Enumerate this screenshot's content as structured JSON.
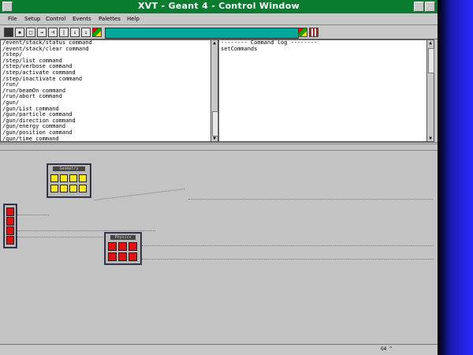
{
  "window": {
    "title": "XVT - Geant 4 - Control Window"
  },
  "menu": [
    "File",
    "Setup",
    "Control",
    "Events",
    "Palettes",
    "Help"
  ],
  "toolbar": {
    "buttons": [
      "save-icon",
      "print-icon",
      "window-icon",
      "arrow-icon",
      "tool-icon",
      "tool-icon",
      "tool-icon",
      "tool-icon",
      "color-icon"
    ],
    "command_value": "",
    "right_buttons": [
      "color-icon",
      "grid-icon"
    ],
    "command_field_color": "#00a89a"
  },
  "command_list": [
    "/event/stack/status command",
    "/event/stack/clear command",
    "/step/",
    "/step/list command",
    "/step/verbose command",
    "/step/activate command",
    "/step/inactivate command",
    "/run/",
    "/run/beamOn command",
    "/run/abort command",
    "/gun/",
    "/gun/List command",
    "/gun/particle command",
    "/gun/direction command",
    "/gun/energy command",
    "/gun/position command",
    "/gun/time command"
  ],
  "command_log": {
    "header": "-------- Command log --------",
    "lines": [
      "setCommands"
    ]
  },
  "palettes": [
    {
      "name": "Geometry",
      "color": "#ffe81a"
    },
    {
      "name": "Physics",
      "color": "#e21010"
    }
  ],
  "status": {
    "text": "G4  ^"
  },
  "colors": {
    "title_bar": "#0a7c2f",
    "workspace": "#c3c3c3",
    "desktop_accent": "#2a2aff"
  }
}
